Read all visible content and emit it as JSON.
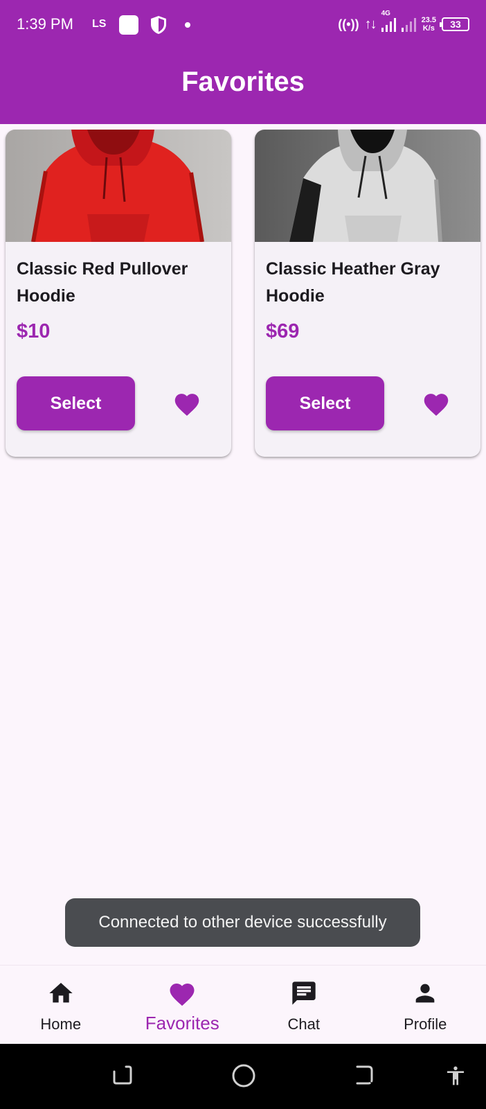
{
  "status_bar": {
    "time": "1:39 PM",
    "carrier_badge": "LS",
    "network": "4G",
    "speed_value": "23.5",
    "speed_unit": "K/s",
    "battery": "33"
  },
  "app_bar": {
    "title": "Favorites"
  },
  "products": [
    {
      "title": "Classic Red Pullover Hoodie",
      "price": "$10",
      "button": "Select",
      "favorited": true,
      "image": "red-hoodie"
    },
    {
      "title": "Classic Heather Gray Hoodie",
      "price": "$69",
      "button": "Select",
      "favorited": true,
      "image": "gray-hoodie"
    }
  ],
  "toast": {
    "message": "Connected to other device successfully"
  },
  "bottom_nav": {
    "items": [
      {
        "label": "Home",
        "icon": "home-icon",
        "active": false
      },
      {
        "label": "Favorites",
        "icon": "heart-icon",
        "active": true
      },
      {
        "label": "Chat",
        "icon": "chat-icon",
        "active": false
      },
      {
        "label": "Profile",
        "icon": "person-icon",
        "active": false
      }
    ]
  },
  "colors": {
    "primary": "#9c27b0",
    "background": "#fcf5fc",
    "card": "#f5f1f7",
    "toast": "#4a4c50"
  }
}
